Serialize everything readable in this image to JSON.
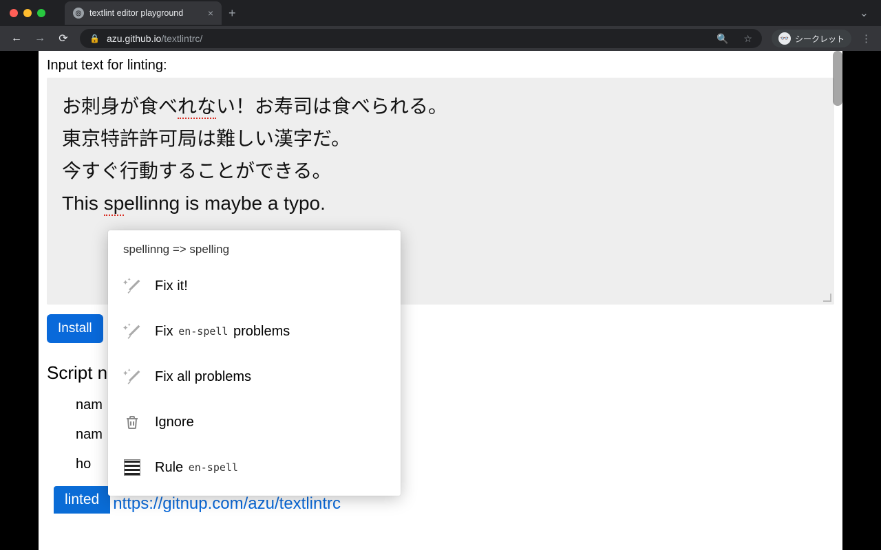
{
  "browser": {
    "tab_title": "textlint editor playground",
    "url_host": "azu.github.io",
    "url_path": "/textlintrc/",
    "incognito_label": "シークレット"
  },
  "page": {
    "heading": "Input text for linting:",
    "editor_lines": [
      {
        "pre": "お刺身が食べ",
        "err": "れな",
        "post": "い！お寿司は食べられる。"
      },
      {
        "plain": "東京特許許可局は難しい漢字だ。"
      },
      {
        "plain": "今すぐ行動することができる。"
      },
      {
        "pre": "This ",
        "err": "sp",
        "post_err": "ellinng is maybe a typo."
      }
    ],
    "install_label": "Install",
    "section_heading": "Script n",
    "meta1": "nam",
    "meta2": "nam",
    "meta3": "ho",
    "linted_label": "linted",
    "url_fragment": "nttps://gitnup.com/azu/textlintrc"
  },
  "popup": {
    "header": "spellinng => spelling",
    "items": [
      {
        "icon": "wand",
        "label": "Fix it!"
      },
      {
        "icon": "wand",
        "label_pre": "Fix ",
        "code": "en-spell",
        "label_post": " problems"
      },
      {
        "icon": "wand",
        "label": "Fix all problems"
      },
      {
        "icon": "trash",
        "label": "Ignore"
      },
      {
        "icon": "rule",
        "label_pre": "Rule ",
        "code": "en-spell"
      }
    ]
  }
}
